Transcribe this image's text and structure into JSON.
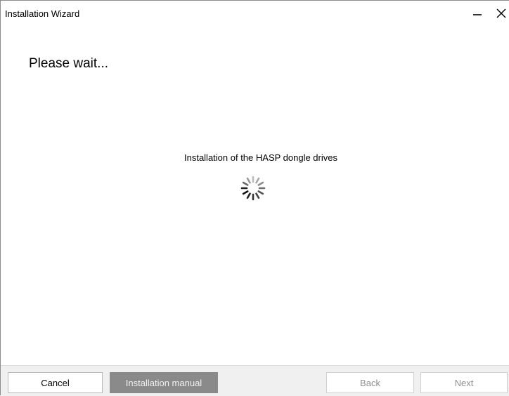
{
  "window": {
    "title": "Installation Wizard",
    "minimize_icon": "minimize-icon",
    "close_icon": "close-icon"
  },
  "main": {
    "heading": "Please wait...",
    "status": "Installation of the HASP dongle drives",
    "spinner_icon": "loading-spinner-icon"
  },
  "footer": {
    "cancel_label": "Cancel",
    "manual_label": "Installation manual",
    "back_label": "Back",
    "next_label": "Next"
  },
  "colors": {
    "footer_bg": "#f0f0f0",
    "manual_button_bg": "#8a8a8a",
    "disabled_text": "#8f8f8f"
  }
}
